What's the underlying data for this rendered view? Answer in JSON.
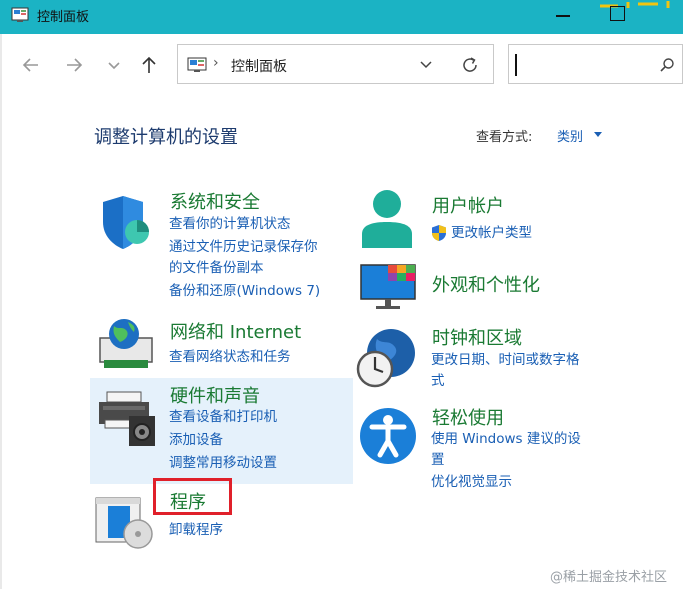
{
  "window": {
    "title": "控制面板"
  },
  "address_bar": {
    "path": "控制面板"
  },
  "search": {
    "placeholder": ""
  },
  "header": {
    "title": "调整计算机的设置",
    "view_label": "查看方式:",
    "view_value": "类别"
  },
  "categories": {
    "system_security": {
      "title": "系统和安全",
      "links": [
        "查看你的计算机状态",
        "通过文件历史记录保存你",
        "的文件备份副本",
        "备份和还原(Windows 7)"
      ]
    },
    "user_accounts": {
      "title": "用户帐户",
      "links": [
        "更改帐户类型"
      ]
    },
    "appearance": {
      "title": "外观和个性化"
    },
    "network": {
      "title": "网络和 Internet",
      "links": [
        "查看网络状态和任务"
      ]
    },
    "clock_region": {
      "title": "时钟和区域",
      "links": [
        "更改日期、时间或数字格",
        "式"
      ]
    },
    "hardware": {
      "title": "硬件和声音",
      "links": [
        "查看设备和打印机",
        "添加设备",
        "调整常用移动设置"
      ]
    },
    "ease": {
      "title": "轻松使用",
      "links": [
        "使用 Windows 建议的设",
        "置",
        "优化视觉显示"
      ]
    },
    "programs": {
      "title": "程序",
      "links": [
        "卸载程序"
      ]
    }
  },
  "watermark": "@稀土掘金技术社区",
  "colors": {
    "titlebar": "#1bb3c4",
    "category_title": "#1a7a33",
    "link": "#1a5fb4",
    "highlight": "#e0202a"
  }
}
